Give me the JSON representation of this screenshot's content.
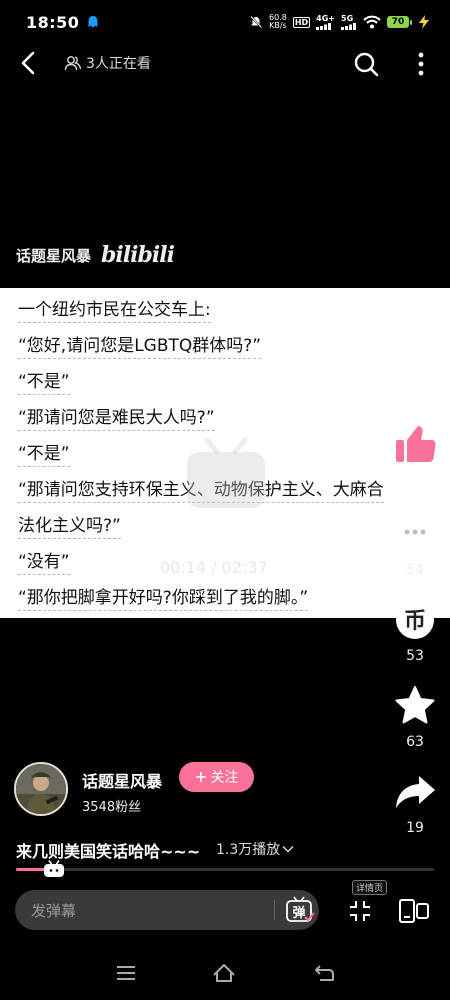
{
  "status_bar": {
    "time": "18:50",
    "net_speed_value": "60.8",
    "net_speed_unit": "KB/s",
    "hd_label": "HD",
    "signal_1": "4G+",
    "signal_2": "5G",
    "battery": "70"
  },
  "top_nav": {
    "viewers": "3人正在看"
  },
  "video": {
    "watermark_text": "话题星风暴",
    "watermark_logo": "bilibili",
    "lines": [
      "一个纽约市民在公交车上:",
      "“您好,请问您是LGBTQ群体吗?”",
      "“不是”",
      "“那请问您是难民大人吗?”",
      "“不是”",
      "“那请问您支持环保主义、动物保护主义、大麻合",
      "法化主义吗?”",
      "“没有”",
      "“那你把脚拿开好吗?你踩到了我的脚。”"
    ],
    "time_display": "00:14 / 02:37",
    "progress": 0.09
  },
  "actions": {
    "like_count": "",
    "comment_count": "54",
    "coin_count": "53",
    "star_count": "63",
    "share_count": "19"
  },
  "uploader": {
    "name": "话题星风暴",
    "follow_label": "关注",
    "fans": "3548粉丝"
  },
  "video_info": {
    "title": "来几则美国笑话哈哈~~~",
    "play_count": "1.3万播放"
  },
  "bottom_bar": {
    "danmaku_placeholder": "发弹幕",
    "danmaku_toggle_label": "弹",
    "details_label": "详情页"
  },
  "colors": {
    "accent": "#fb7299",
    "background": "#000000",
    "battery": "#8bd64a"
  }
}
